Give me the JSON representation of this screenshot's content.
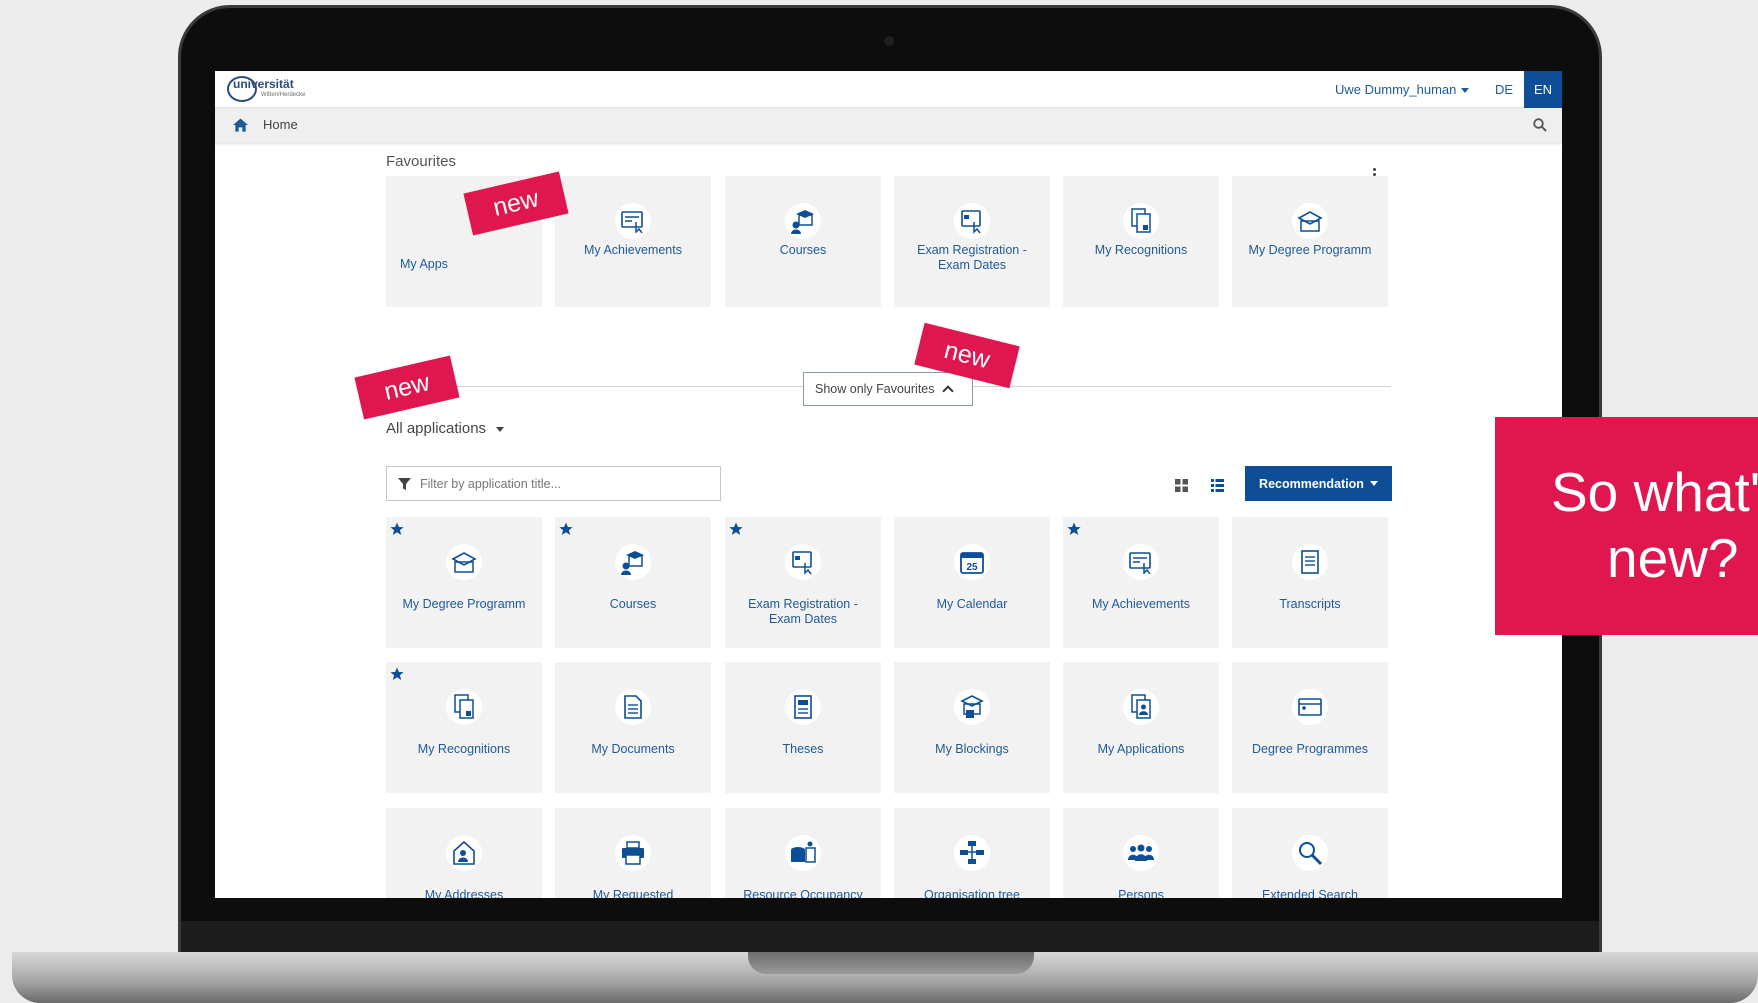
{
  "header": {
    "logo": "universität",
    "logo_sub": "Witten/Herdecke",
    "user": "Uwe Dummy_human",
    "lang_de": "DE",
    "lang_en": "EN"
  },
  "nav": {
    "home": "Home"
  },
  "favourites": {
    "title": "Favourites",
    "tiles": [
      {
        "label": "My Apps"
      },
      {
        "label": "My Achievements"
      },
      {
        "label": "Courses"
      },
      {
        "label": "Exam Registration - Exam Dates"
      },
      {
        "label": "My Recognitions"
      },
      {
        "label": "My Degree Programm"
      }
    ]
  },
  "show_favourites": "Show only Favourites",
  "all_apps": {
    "title": "All applications",
    "filter_placeholder": "Filter by application title...",
    "recommendation": "Recommendation",
    "rows": [
      [
        {
          "label": "My Degree Programm",
          "fav": true
        },
        {
          "label": "Courses",
          "fav": true
        },
        {
          "label": "Exam Registration - Exam Dates",
          "fav": true
        },
        {
          "label": "My Calendar",
          "fav": false,
          "icon_text": "25"
        },
        {
          "label": "My Achievements",
          "fav": true
        },
        {
          "label": "Transcripts",
          "fav": false
        }
      ],
      [
        {
          "label": "My Recognitions",
          "fav": true
        },
        {
          "label": "My Documents",
          "fav": false
        },
        {
          "label": "Theses",
          "fav": false
        },
        {
          "label": "My Blockings",
          "fav": false
        },
        {
          "label": "My Applications",
          "fav": false
        },
        {
          "label": "Degree Programmes",
          "fav": false
        }
      ],
      [
        {
          "label": "My Addresses",
          "fav": false
        },
        {
          "label": "My Requested",
          "fav": false
        },
        {
          "label": "Resource Occupancy",
          "fav": false
        },
        {
          "label": "Organisation tree",
          "fav": false
        },
        {
          "label": "Persons",
          "fav": false
        },
        {
          "label": "Extended Search",
          "fav": false
        }
      ]
    ]
  },
  "overlays": {
    "new_tag": "new",
    "promo_line1": "So what's",
    "promo_line2": "new?"
  },
  "colors": {
    "primary": "#0d4e96",
    "accent": "#e0164f",
    "tile_bg": "#f2f2f2",
    "link": "#1f5a97"
  }
}
